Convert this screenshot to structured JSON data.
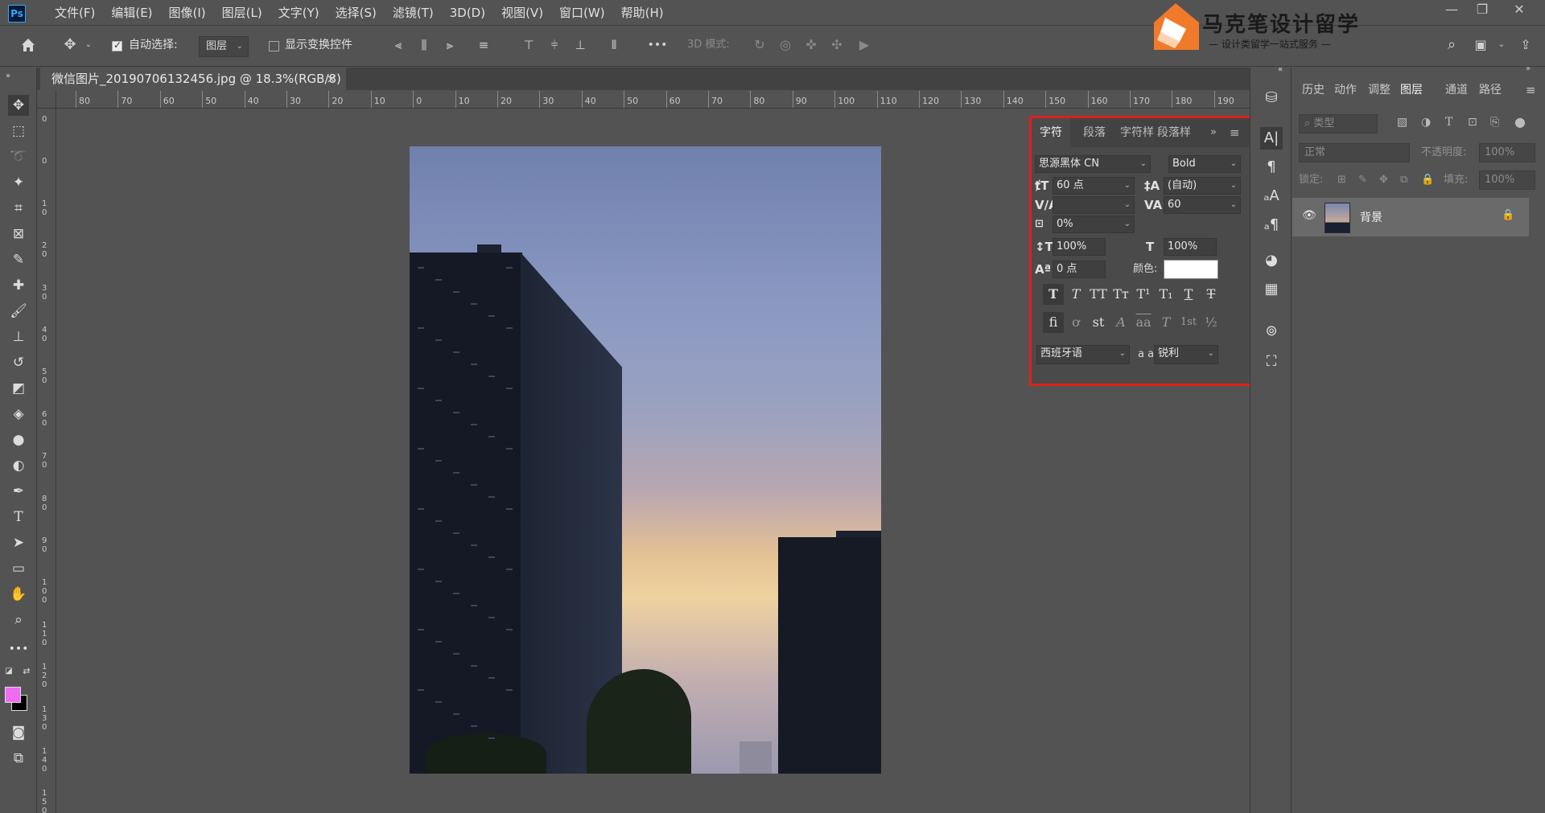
{
  "app": {
    "logo_text": "Ps"
  },
  "menu": [
    "文件(F)",
    "编辑(E)",
    "图像(I)",
    "图层(L)",
    "文字(Y)",
    "选择(S)",
    "滤镜(T)",
    "3D(D)",
    "视图(V)",
    "窗口(W)",
    "帮助(H)"
  ],
  "window_controls": {
    "minimize": "—",
    "restore": "❐",
    "close": "✕"
  },
  "brand": {
    "title": "马克笔设计留学",
    "subtitle": "— 设计类留学一站式服务 —"
  },
  "options": {
    "auto_select_label": "自动选择:",
    "auto_select_value": "图层",
    "show_transform_label": "显示变换控件",
    "more": "•••",
    "mode_3d_label": "3D 模式:"
  },
  "document": {
    "tab_title": "微信图片_20190706132456.jpg @ 18.3%(RGB/8)",
    "close": "×"
  },
  "ruler_top": [
    "80",
    "70",
    "60",
    "50",
    "40",
    "30",
    "20",
    "10",
    "0",
    "10",
    "20",
    "30",
    "40",
    "50",
    "60",
    "70",
    "80",
    "90",
    "100",
    "110",
    "120",
    "130",
    "140",
    "150",
    "160",
    "170",
    "180",
    "190"
  ],
  "ruler_left": [
    "0",
    "0",
    "1\n0",
    "2\n0",
    "3\n0",
    "4\n0",
    "5\n0",
    "6\n0",
    "7\n0",
    "8\n0",
    "9\n0",
    "1\n0\n0",
    "1\n1\n0",
    "1\n2\n0",
    "1\n3\n0",
    "1\n4\n0",
    "1\n5\n0"
  ],
  "character_panel": {
    "tabs": [
      "字符",
      "段落",
      "字符样",
      "段落样"
    ],
    "overflow": "»",
    "font_family": "思源黑体 CN",
    "font_style": "Bold",
    "font_size": "60 点",
    "leading": "(自动)",
    "kerning": "",
    "tracking": "60",
    "tsume": "0%",
    "vertical_scale": "100%",
    "horizontal_scale": "100%",
    "baseline_shift": "0 点",
    "color_label": "颜色:",
    "color_value": "#ffffff",
    "style_row1": [
      "T",
      "T",
      "TT",
      "Tт",
      "T¹",
      "T₁",
      "T",
      "T"
    ],
    "style_row2": [
      "fi",
      "ơ",
      "st",
      "A",
      "aa",
      "T",
      "1st",
      "½"
    ],
    "language": "西班牙语",
    "aa_label": "a a",
    "antialias": "锐利"
  },
  "right_panel": {
    "tabs": [
      "历史",
      "动作",
      "调整",
      "图层",
      "通道",
      "路径"
    ],
    "filter_placeholder": "类型",
    "blend_mode": "正常",
    "opacity_label": "不透明度:",
    "opacity_value": "100%",
    "lock_label": "锁定:",
    "fill_label": "填充:",
    "fill_value": "100%",
    "layer_name": "背景"
  },
  "colors": {
    "foreground": "#ef6cf2",
    "background": "#000000",
    "highlight_box": "#e0201b"
  }
}
